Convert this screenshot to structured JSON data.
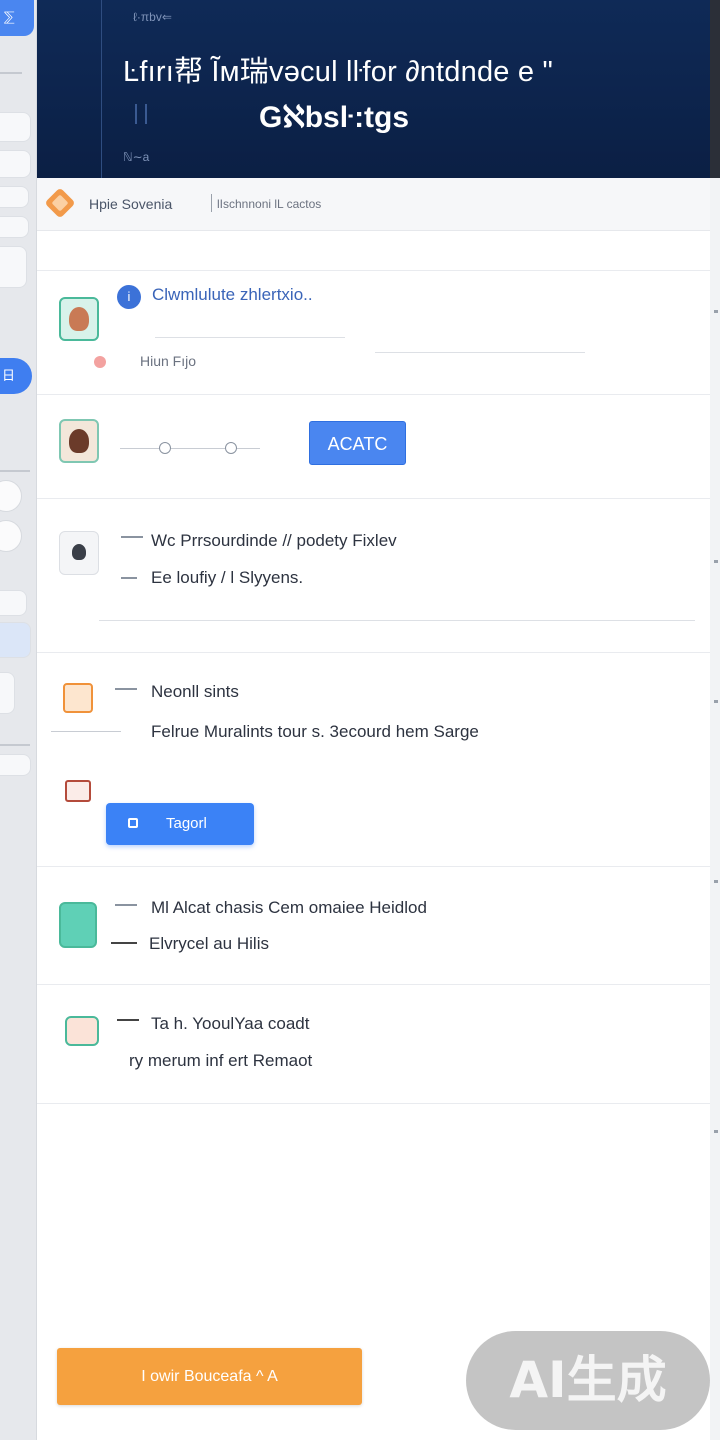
{
  "sidebar": {
    "top_glyph": "⅀",
    "pill_glyph": "日"
  },
  "header": {
    "breadcrumb": "ℓ·πbv⇐",
    "title": "Ŀfırı帮 Ĩм瑞vəcul lŀfor ∂ntdnde e \"",
    "subtitle": "Gℵbsŀ:tgs",
    "footnote": "ℕ∼a"
  },
  "subbar": {
    "label": "Hpie Sovenia",
    "right_label": "lIschnnoni lL cactos"
  },
  "rows": [
    {
      "title": "Clwmlulute zhlertxio..",
      "meta": "Hiun Fıjo"
    },
    {
      "cta_label": "ACATC"
    },
    {
      "line1": "Wc Prrsourdinde // podety Fixlev",
      "line2": "Ee loufiy / l Slyyens."
    },
    {
      "line1": "Neonll sints",
      "line2": "Felrue Muralints tour   s. 3ecourd hem Sarge",
      "button_label": "Tagorl"
    },
    {
      "line1": "Ml Alcat chasis  Cem omaiee Heidlod",
      "line2": "Elvrycel au         Hilis"
    },
    {
      "line1": "Ta h. YooulYaa          coadt",
      "line2": "    ry merum  inf        ert Remaot"
    }
  ],
  "footer": {
    "button_label": "I owir Bouceafa ^ A"
  },
  "watermark": {
    "text": "AI生成"
  },
  "colors": {
    "hero_bg": "#0f2a57",
    "accent_blue": "#3b82f6",
    "accent_orange": "#f5a13f",
    "teal": "#4ab99a"
  }
}
